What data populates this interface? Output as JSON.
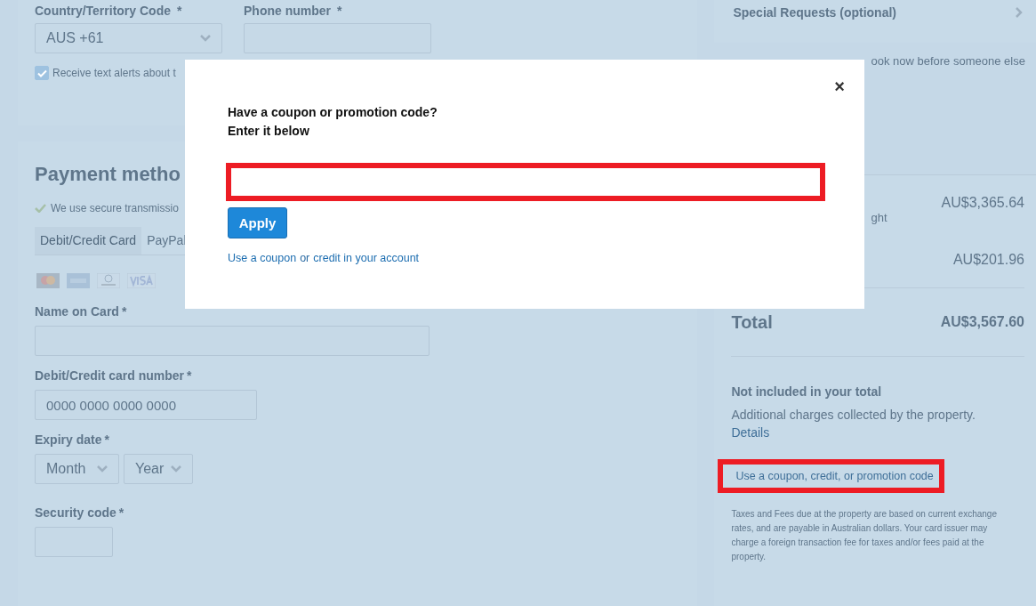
{
  "contact": {
    "country_label": "Country/Territory Code",
    "country_value": "AUS +61",
    "phone_label": "Phone number",
    "required_mark": "*",
    "sms_checkbox": {
      "label": "Receive text alerts about t",
      "checked": true
    }
  },
  "payment": {
    "heading": "Payment metho",
    "secure_note": "We use secure transmissio",
    "tabs": [
      {
        "label": "Debit/Credit Card",
        "selected": true
      },
      {
        "label": "PayPal",
        "selected": false
      }
    ],
    "name_label": "Name on Card",
    "number_label": "Debit/Credit card number",
    "number_placeholder": "0000 0000 0000 0000",
    "expiry_label": "Expiry date",
    "month_value": "Month",
    "year_value": "Year",
    "security_label": "Security code",
    "required_mark": "*"
  },
  "summary": {
    "special_requests": "Special Requests (optional)",
    "urgency_fragment": "ook now before someone else",
    "rows": [
      {
        "price": "AU$3,365.64",
        "fragment": "ght"
      },
      {
        "price": "AU$201.96",
        "fragment": ""
      }
    ],
    "total_label": "Total",
    "total_value": "AU$3,567.60",
    "not_included_heading": "Not included in your total",
    "additional_text": "Additional charges collected by the property.",
    "details_link": "Details",
    "coupon_link": {
      "label": "Use a coupon, credit, or promotion code",
      "highlighted": true
    },
    "fine_print": "Taxes and Fees due at the property are based on current exchange rates, and are payable in Australian dollars. Your card issuer may charge a foreign transaction fee for taxes and/or fees paid at the property."
  },
  "modal": {
    "close": "×",
    "title_line_1": "Have a coupon or promotion code?",
    "title_line_2": "Enter it below",
    "code_field": {
      "highlighted": true
    },
    "apply_button": "Apply",
    "account_link_1": "Use a coupon",
    "account_link_or": "or",
    "account_link_2": "credit in your account"
  }
}
